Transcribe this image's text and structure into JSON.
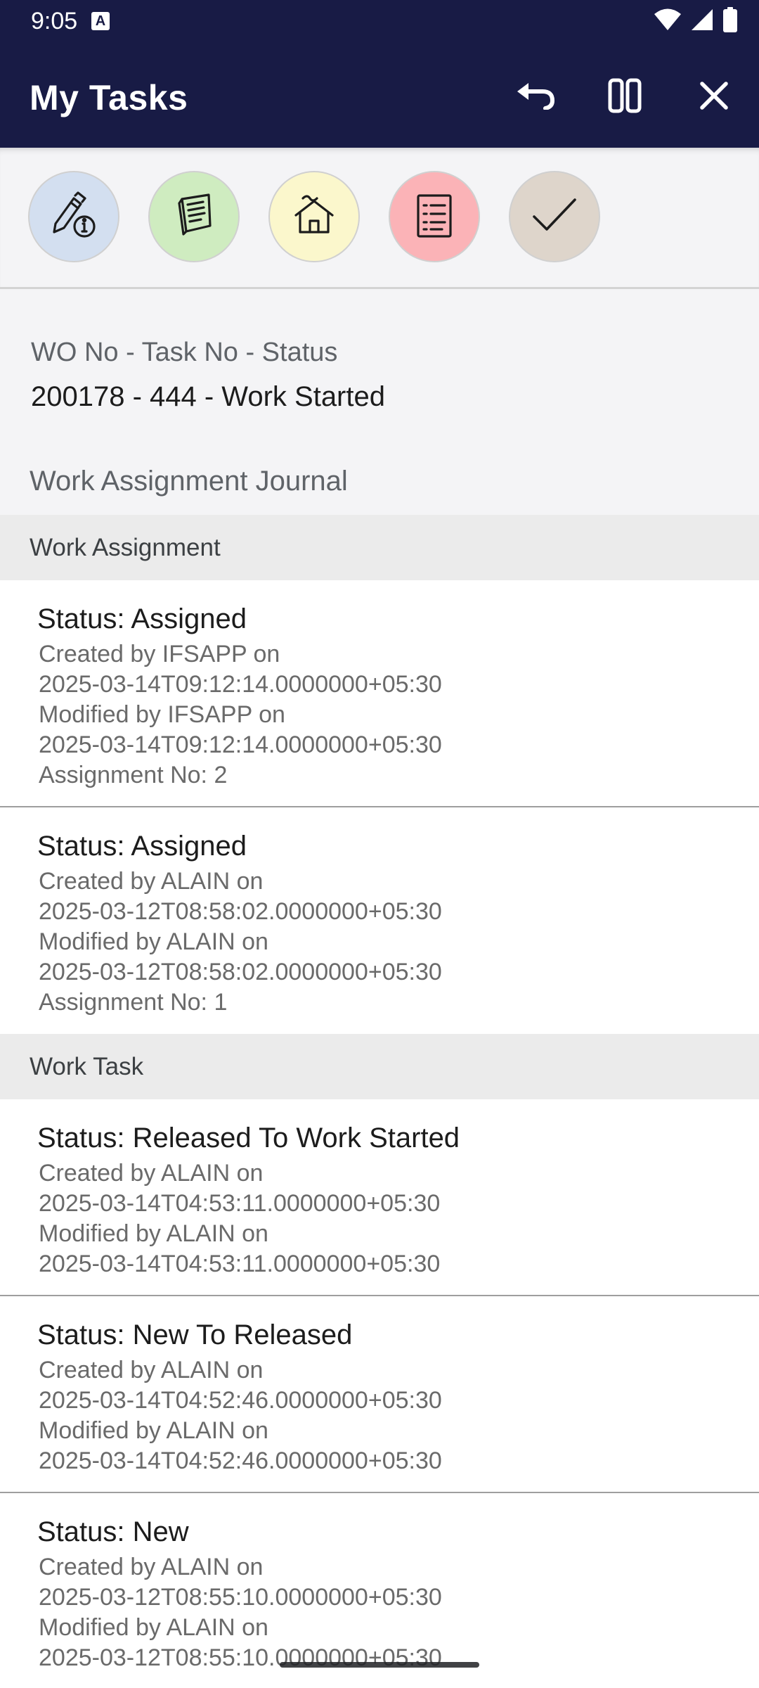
{
  "status_bar": {
    "time": "9:05",
    "notification_badge": "A",
    "icons": [
      "wifi-icon",
      "cell-signal-icon",
      "battery-icon"
    ]
  },
  "app_bar": {
    "title": "My Tasks",
    "actions": [
      "undo-icon",
      "split-view-icon",
      "close-icon"
    ]
  },
  "quick_actions": [
    {
      "name": "edit-info-icon",
      "color": "#d3dff0"
    },
    {
      "name": "documents-icon",
      "color": "#cfecc0"
    },
    {
      "name": "home-icon",
      "color": "#fbf7cc"
    },
    {
      "name": "checklist-icon",
      "color": "#fbb3b7"
    },
    {
      "name": "checkmark-icon",
      "color": "#ded5cb"
    }
  ],
  "task_info": {
    "label": "WO No - Task No - Status",
    "value": "200178 - 444 - Work Started"
  },
  "journal": {
    "title": "Work Assignment Journal",
    "sections": [
      {
        "header": "Work Assignment",
        "entries": [
          {
            "status": "Status: Assigned",
            "lines": [
              "Created by IFSAPP on",
              "2025-03-14T09:12:14.0000000+05:30",
              "Modified by IFSAPP on",
              "2025-03-14T09:12:14.0000000+05:30",
              "Assignment No: 2"
            ]
          },
          {
            "status": "Status: Assigned",
            "lines": [
              "Created by ALAIN on",
              "2025-03-12T08:58:02.0000000+05:30",
              "Modified by ALAIN on",
              "2025-03-12T08:58:02.0000000+05:30",
              "Assignment No: 1"
            ]
          }
        ]
      },
      {
        "header": "Work Task",
        "entries": [
          {
            "status": "Status: Released To Work Started",
            "lines": [
              "Created by ALAIN on",
              "2025-03-14T04:53:11.0000000+05:30",
              "Modified by ALAIN on",
              "2025-03-14T04:53:11.0000000+05:30"
            ]
          },
          {
            "status": "Status: New To Released",
            "lines": [
              "Created by ALAIN on",
              "2025-03-14T04:52:46.0000000+05:30",
              "Modified by ALAIN on",
              "2025-03-14T04:52:46.0000000+05:30"
            ]
          },
          {
            "status": "Status: New",
            "lines": [
              "Created by ALAIN on",
              "2025-03-12T08:55:10.0000000+05:30",
              "Modified by ALAIN on",
              "2025-03-12T08:55:10.0000000+05:30"
            ]
          }
        ]
      }
    ]
  }
}
